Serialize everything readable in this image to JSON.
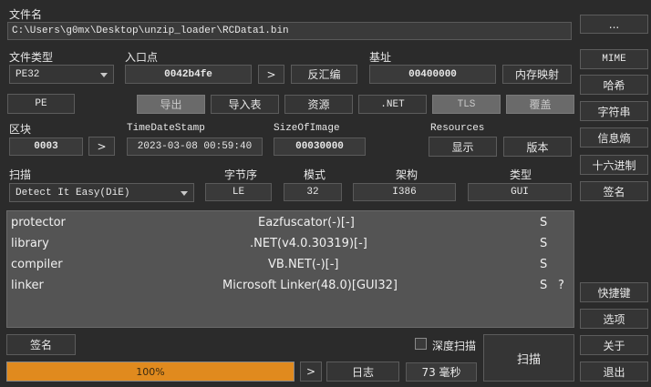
{
  "file": {
    "label": "文件名",
    "path": "C:\\Users\\g0mx\\Desktop\\unzip_loader\\RCData1.bin",
    "browse": "..."
  },
  "filetype": {
    "label": "文件类型",
    "value": "PE32"
  },
  "entrypoint": {
    "label": "入口点",
    "value": "0042b4fe",
    "go": ">",
    "disasm": "反汇编"
  },
  "base": {
    "label": "基址",
    "value": "00400000",
    "memmap": "内存映射"
  },
  "toolbar": {
    "pe": "PE",
    "export": "导出",
    "import": "导入表",
    "resources": "资源",
    "net": ".NET",
    "tls": "TLS",
    "overlay": "覆盖"
  },
  "sections": {
    "label": "区块",
    "value": "0003",
    "go": ">"
  },
  "timestamp": {
    "label": "TimeDateStamp",
    "value": "2023-03-08 00:59:40"
  },
  "sizeofimage": {
    "label": "SizeOfImage",
    "value": "00030000"
  },
  "resources_group": {
    "label": "Resources",
    "show": "显示",
    "version": "版本"
  },
  "scan": {
    "label": "扫描",
    "engine": "Detect It Easy(DiE)"
  },
  "endianness": {
    "label": "字节序",
    "value": "LE"
  },
  "mode": {
    "label": "模式",
    "value": "32"
  },
  "arch": {
    "label": "架构",
    "value": "I386"
  },
  "type": {
    "label": "类型",
    "value": "GUI"
  },
  "results": [
    {
      "kind": "protector",
      "name": "Eazfuscator(-)[-]",
      "flag": "S",
      "extra": ""
    },
    {
      "kind": "library",
      "name": ".NET(v4.0.30319)[-]",
      "flag": "S",
      "extra": ""
    },
    {
      "kind": "compiler",
      "name": "VB.NET(-)[-]",
      "flag": "S",
      "extra": ""
    },
    {
      "kind": "linker",
      "name": "Microsoft Linker(48.0)[GUI32]",
      "flag": "S",
      "extra": "?"
    }
  ],
  "right_panel": {
    "mime": "MIME",
    "hash": "哈希",
    "strings": "字符串",
    "entropy": "信息熵",
    "hex": "十六进制",
    "signature": "签名",
    "shortcuts": "快捷键",
    "options": "选项",
    "about": "关于",
    "exit": "退出"
  },
  "bottom": {
    "signature": "签名",
    "deep_scan": "深度扫描",
    "scan": "扫描",
    "progress_text": "100%",
    "progress": 1.0,
    "go": ">",
    "log": "日志",
    "time": "73 毫秒"
  }
}
